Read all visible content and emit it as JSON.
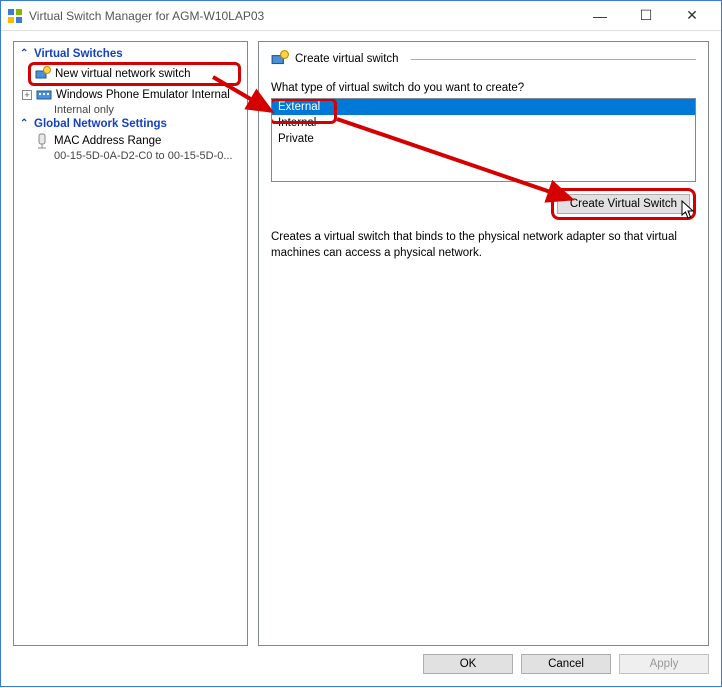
{
  "window": {
    "title": "Virtual Switch Manager for AGM-W10LAP03"
  },
  "tree": {
    "section1": "Virtual Switches",
    "new_switch": "New virtual network switch",
    "emulator": "Windows Phone Emulator Internal",
    "emulator_sub": "Internal only",
    "section2": "Global Network Settings",
    "mac_range": "MAC Address Range",
    "mac_range_sub": "00-15-5D-0A-D2-C0 to 00-15-5D-0..."
  },
  "panel": {
    "heading": "Create virtual switch",
    "question": "What type of virtual switch do you want to create?",
    "options": {
      "external": "External",
      "internal": "Internal",
      "private": "Private"
    },
    "create_btn": "Create Virtual Switch",
    "description": "Creates a virtual switch that binds to the physical network adapter so that virtual machines can access a physical network."
  },
  "footer": {
    "ok": "OK",
    "cancel": "Cancel",
    "apply": "Apply"
  }
}
